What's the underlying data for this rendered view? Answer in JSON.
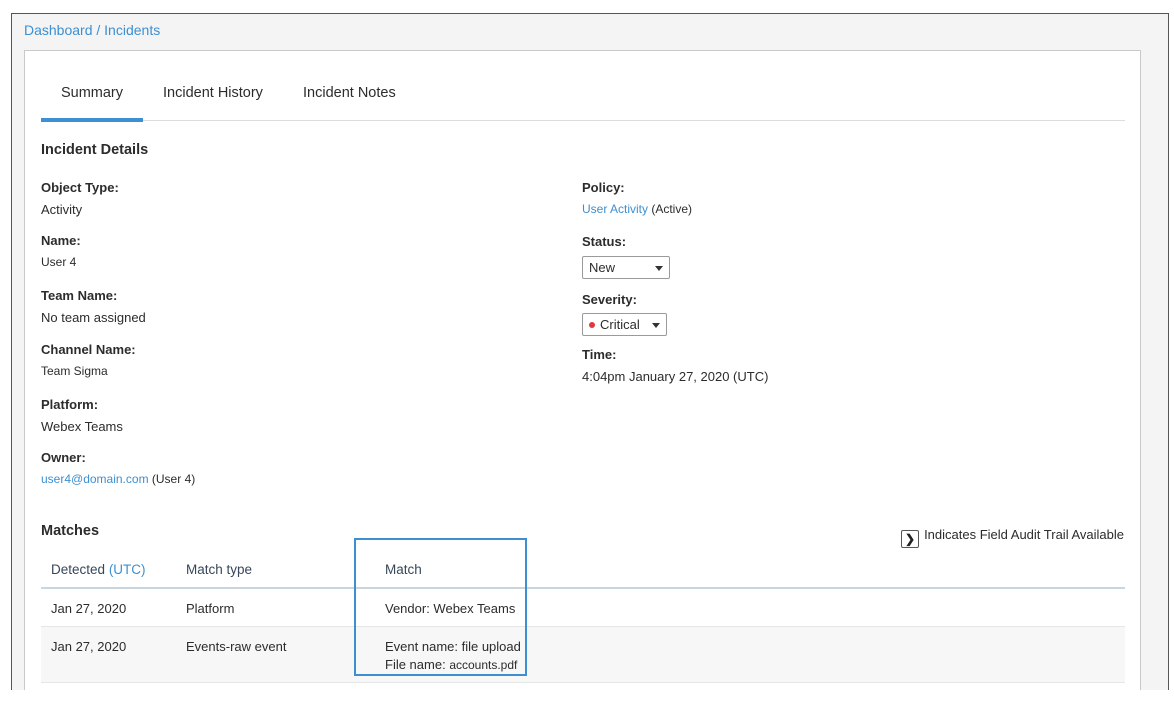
{
  "breadcrumb": {
    "dashboard": "Dashboard",
    "separator": " / ",
    "current": "Incidents"
  },
  "tabs": [
    {
      "label": "Summary",
      "active": true
    },
    {
      "label": "Incident History",
      "active": false
    },
    {
      "label": "Incident Notes",
      "active": false
    }
  ],
  "details": {
    "title": "Incident Details",
    "object_type": {
      "label": "Object Type:",
      "value": "Activity"
    },
    "name": {
      "label": "Name:",
      "value": "User 4"
    },
    "team_name": {
      "label": "Team Name:",
      "value": "No team assigned"
    },
    "channel_name": {
      "label": "Channel Name:",
      "value": "Team Sigma"
    },
    "platform": {
      "label": "Platform:",
      "value": "Webex Teams"
    },
    "owner": {
      "label": "Owner:",
      "email": "user4@domain.com",
      "suffix": " (User 4)"
    },
    "policy": {
      "label": "Policy:",
      "link": "User Activity",
      "suffix": " (Active)"
    },
    "status": {
      "label": "Status:",
      "value": "New"
    },
    "severity": {
      "label": "Severity:",
      "value": "Critical",
      "color": "#e0393e"
    },
    "time": {
      "label": "Time:",
      "value": "4:04pm January 27, 2020 (UTC)"
    }
  },
  "matches": {
    "title": "Matches",
    "audit_note": "Indicates Field Audit Trail Available",
    "audit_icon": "chevron-right-icon",
    "columns": {
      "detected": "Detected",
      "detected_utc": "(UTC)",
      "match_type": "Match type",
      "match": "Match"
    },
    "rows": [
      {
        "detected": "Jan 27, 2020",
        "match_type": "Platform",
        "match_line1": "Vendor: Webex Teams"
      },
      {
        "detected": "Jan 27, 2020",
        "match_type": "Events-raw event",
        "match_line1": "Event name: file upload",
        "match_line2_label": "File name: ",
        "match_line2_value": "accounts.pdf"
      }
    ]
  },
  "colors": {
    "accent": "#3d8fd1",
    "critical": "#e0393e"
  }
}
